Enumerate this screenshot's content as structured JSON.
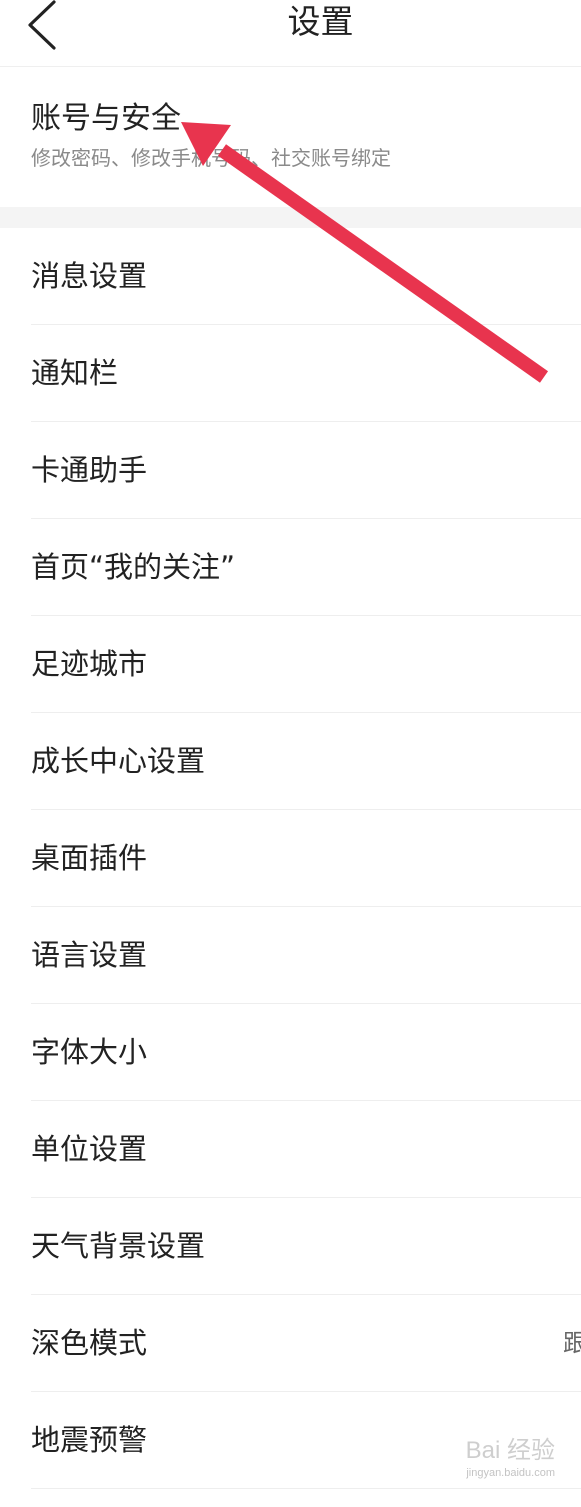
{
  "header": {
    "title": "设置",
    "back_icon": "chevron-left-icon"
  },
  "account": {
    "title": "账号与安全",
    "subtitle": "修改密码、修改手机号码、社交账号绑定"
  },
  "items": [
    {
      "label": "消息设置"
    },
    {
      "label": "通知栏"
    },
    {
      "label": "卡通助手"
    },
    {
      "label": "首页“我的关注”"
    },
    {
      "label": "足迹城市"
    },
    {
      "label": "成长中心设置"
    },
    {
      "label": "桌面插件"
    },
    {
      "label": "语言设置"
    },
    {
      "label": "字体大小"
    },
    {
      "label": "单位设置"
    },
    {
      "label": "天气背景设置"
    },
    {
      "label": "深色模式",
      "value": "跟"
    },
    {
      "label": "地震预警"
    }
  ],
  "annotation": {
    "arrow_color": "#e8344e"
  },
  "watermark": {
    "brand": "Bai 经验",
    "site": "jingyan.baidu.com"
  }
}
